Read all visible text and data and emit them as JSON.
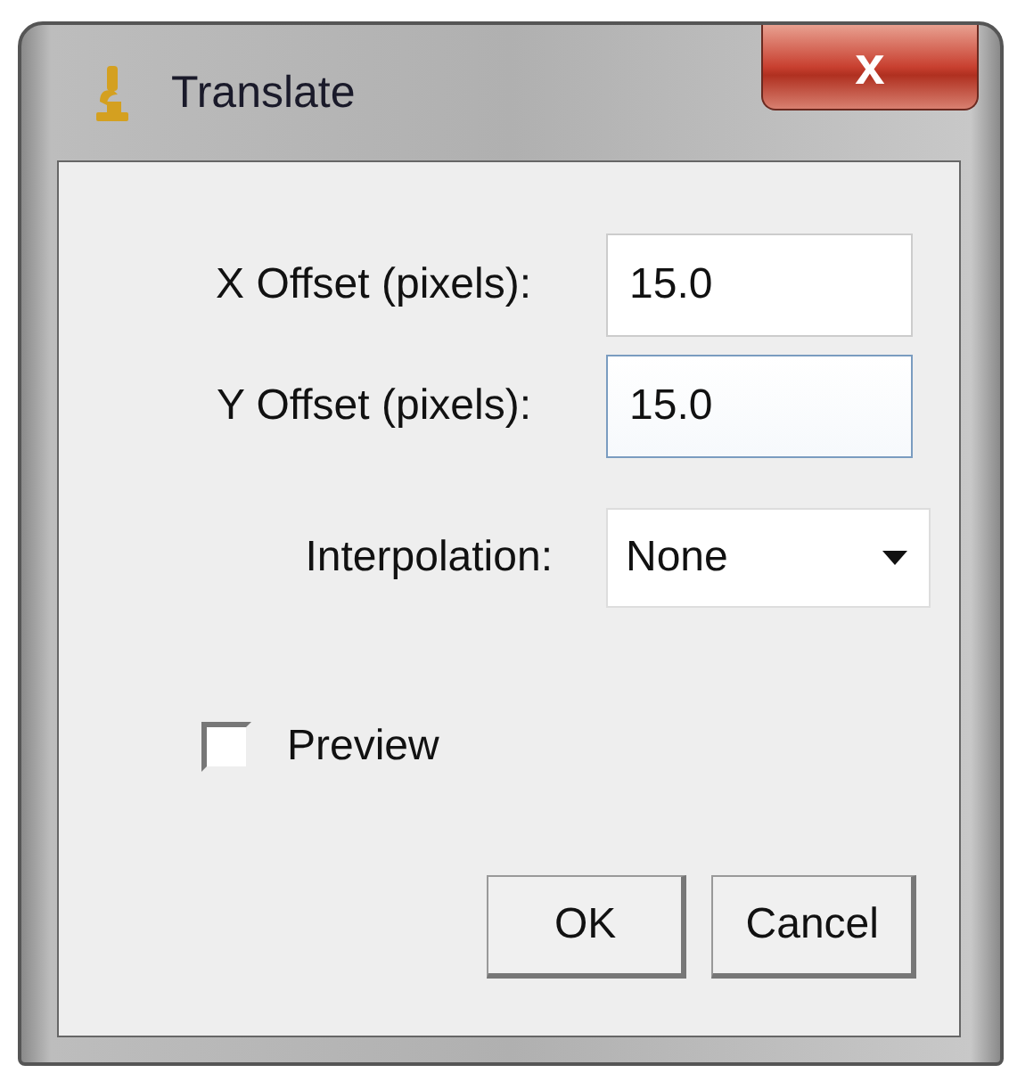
{
  "window": {
    "title": "Translate",
    "close_label": "x"
  },
  "fields": [
    {
      "label": "X Offset (pixels):",
      "value": "15.0",
      "focused": false
    },
    {
      "label": "Y Offset (pixels):",
      "value": "15.0",
      "focused": true
    }
  ],
  "interpolation": {
    "label": "Interpolation:",
    "value": "None"
  },
  "preview": {
    "label": "Preview",
    "checked": false
  },
  "buttons": [
    "OK",
    "Cancel"
  ]
}
